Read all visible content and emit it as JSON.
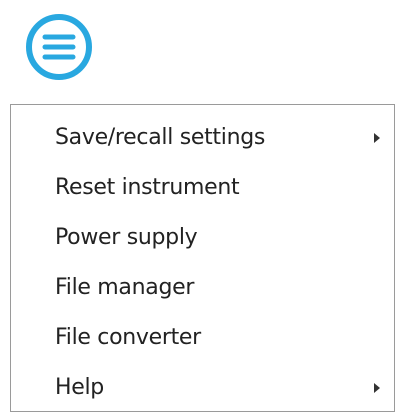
{
  "menu_button": {
    "icon": "hamburger-menu-icon",
    "accent_color": "#29a8e0"
  },
  "menu": {
    "items": [
      {
        "label": "Save/recall settings",
        "has_submenu": true
      },
      {
        "label": "Reset instrument",
        "has_submenu": false
      },
      {
        "label": "Power supply",
        "has_submenu": false
      },
      {
        "label": "File manager",
        "has_submenu": false
      },
      {
        "label": "File converter",
        "has_submenu": false
      },
      {
        "label": "Help",
        "has_submenu": true
      }
    ]
  }
}
